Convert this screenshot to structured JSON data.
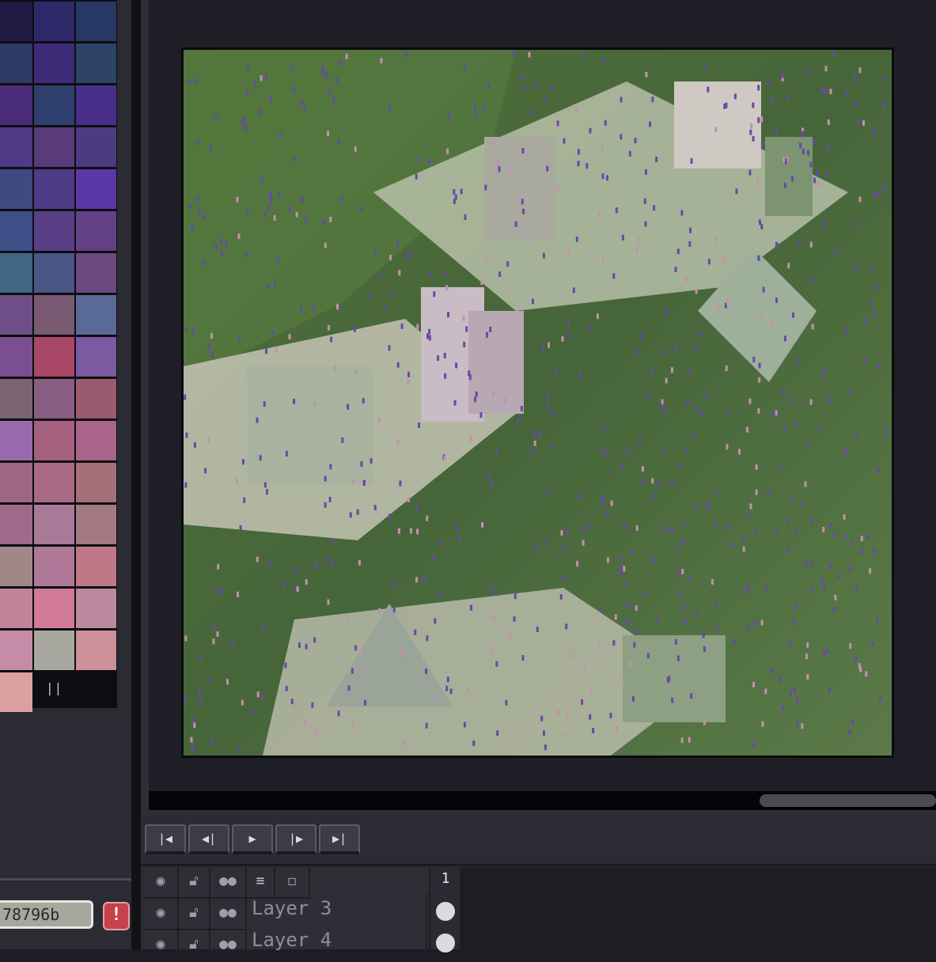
{
  "palette": {
    "colors": [
      "#221a42",
      "#2e2868",
      "#273866",
      "#2d3a66",
      "#3d2b78",
      "#2e4466",
      "#4a2b7a",
      "#2e3f6e",
      "#4a2f8a",
      "#4f3a86",
      "#593a7a",
      "#4b3c80",
      "#3f4a82",
      "#4e3c86",
      "#5c38a6",
      "#3d4f86",
      "#583f86",
      "#624184",
      "#3f6682",
      "#4b5688",
      "#6a4a80",
      "#6e4f88",
      "#7a5a72",
      "#5a6a98",
      "#7a4e90",
      "#a84866",
      "#7a5aa0",
      "#7a6470",
      "#8a5e82",
      "#9a5a70",
      "#9a6ab0",
      "#a4607c",
      "#a8648a",
      "#9e6882",
      "#a86a84",
      "#a4707a",
      "#a06a8a",
      "#a87a98",
      "#a47a82",
      "#a08888",
      "#b07898",
      "#c07888",
      "#c0849a",
      "#d07a98",
      "#bc8aa0",
      "#c48ca6",
      "#a8a8a0",
      "#cc9098",
      "#dca0a0"
    ],
    "handle_label": "||"
  },
  "color_field": {
    "value": "78796b",
    "warning_label": "!"
  },
  "artwork": {
    "name": "overgrown-isometric-city"
  },
  "playback": {
    "buttons": [
      {
        "name": "first-frame-button",
        "glyph": "|◀",
        "icon": "skip-start-icon"
      },
      {
        "name": "previous-frame-button",
        "glyph": "◀|",
        "icon": "step-back-icon"
      },
      {
        "name": "play-button",
        "glyph": "▶",
        "icon": "play-icon"
      },
      {
        "name": "next-frame-button",
        "glyph": "|▶",
        "icon": "step-forward-icon"
      },
      {
        "name": "last-frame-button",
        "glyph": "▶|",
        "icon": "skip-end-icon"
      }
    ]
  },
  "layers": {
    "header_icons": {
      "visibility": "eye-icon",
      "lock": "lock-icon",
      "link": "link-icon",
      "group": "layer-group-icon",
      "new": "new-layer-icon"
    },
    "items": [
      {
        "name": "Layer 3"
      },
      {
        "name": "Layer 4"
      }
    ],
    "frame_number": "1"
  }
}
